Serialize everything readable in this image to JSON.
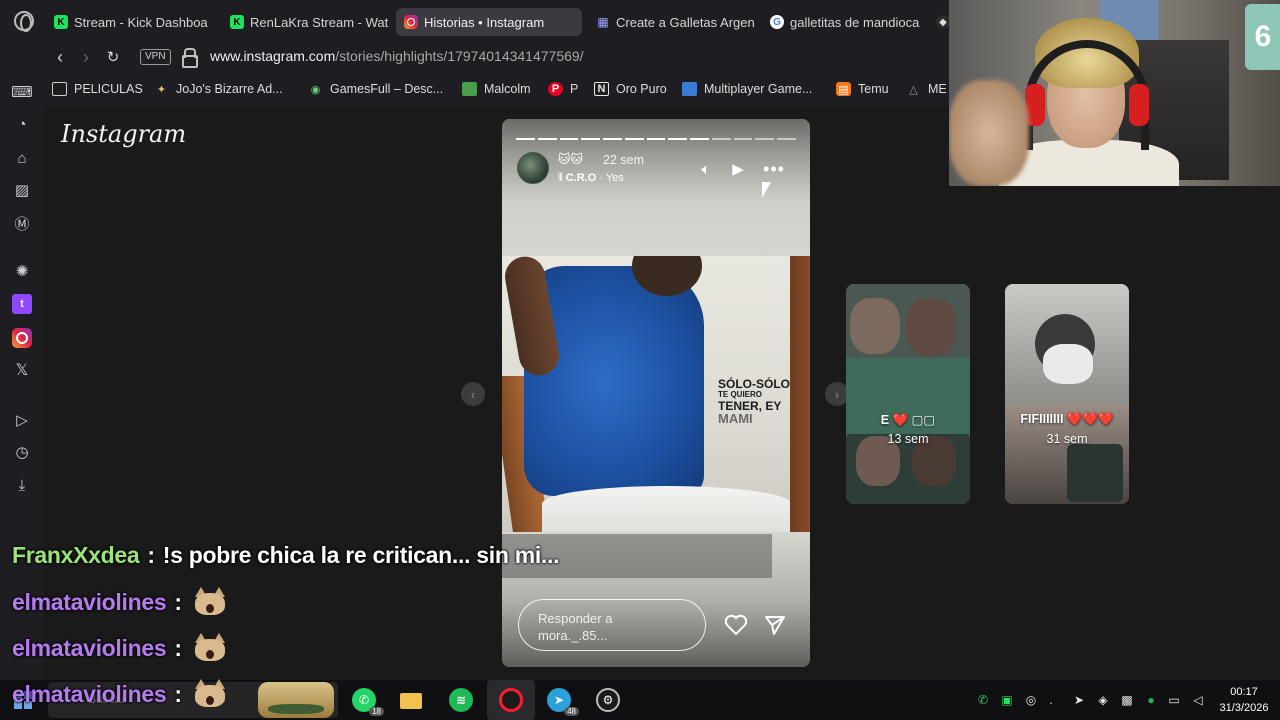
{
  "browser": {
    "tabs": [
      {
        "label": "Stream - Kick Dashboa",
        "icon": "kick-icon",
        "active": false
      },
      {
        "label": "RenLaKra Stream - Wat",
        "icon": "kick-icon",
        "active": false
      },
      {
        "label": "Historias • Instagram",
        "icon": "instagram-icon",
        "active": true
      },
      {
        "label": "Create a Galletas Argen",
        "icon": "doc-icon",
        "active": false
      },
      {
        "label": "galletitas de mandioca",
        "icon": "google-icon",
        "active": false
      }
    ],
    "vpn_label": "VPN",
    "url_domain": "www.instagram.com",
    "url_path": "/stories/highlights/17974014341477569/",
    "bookmarks": [
      "PELICULAS",
      "JoJo's Bizarre Ad...",
      "GamesFull – Desc...",
      "Malcolm",
      "P",
      "Oro Puro",
      "Multiplayer Game...",
      "Temu",
      "ME"
    ],
    "sidebar_labels": {
      "gx": "GX",
      "more": "•••"
    }
  },
  "instagram": {
    "logo": "Instagram",
    "story": {
      "user": "🐱🐱",
      "time": "22 sem",
      "music_prefix": "C.R.O",
      "music_suffix": " · Yes",
      "progress_total": 13,
      "progress_done": 9,
      "lyric_lines": [
        "SÓLO-SÓLO",
        "TE QUIERO",
        "TENER, EY",
        "MAMI"
      ],
      "reply_placeholder_1": "Responder a",
      "reply_placeholder_2": "mora._.85..."
    },
    "previews": [
      {
        "name": "E ❤️ ▢▢",
        "time": "13 sem"
      },
      {
        "name": "FIFIIIIIII ❤️❤️❤️",
        "time": "31 sem"
      }
    ]
  },
  "chat": [
    {
      "user": "FranxXxdea",
      "color": "green",
      "message": "!s pobre chica la re critican... sin mi..."
    },
    {
      "user": "elmataviolines",
      "color": "purple",
      "message": "",
      "emote": "cat-emote"
    },
    {
      "user": "elmataviolines",
      "color": "purple",
      "message": "",
      "emote": "cat-emote"
    },
    {
      "user": "elmataviolines",
      "color": "purple",
      "message": "",
      "emote": "cat-emote"
    }
  ],
  "chat_separator": ":",
  "webcam": {
    "badge": "6"
  },
  "taskbar": {
    "search_placeholder": "Buscar",
    "whatsapp_badge": "18",
    "telegram_badge": "48",
    "time": "00:17",
    "date": "31/3/2026"
  }
}
